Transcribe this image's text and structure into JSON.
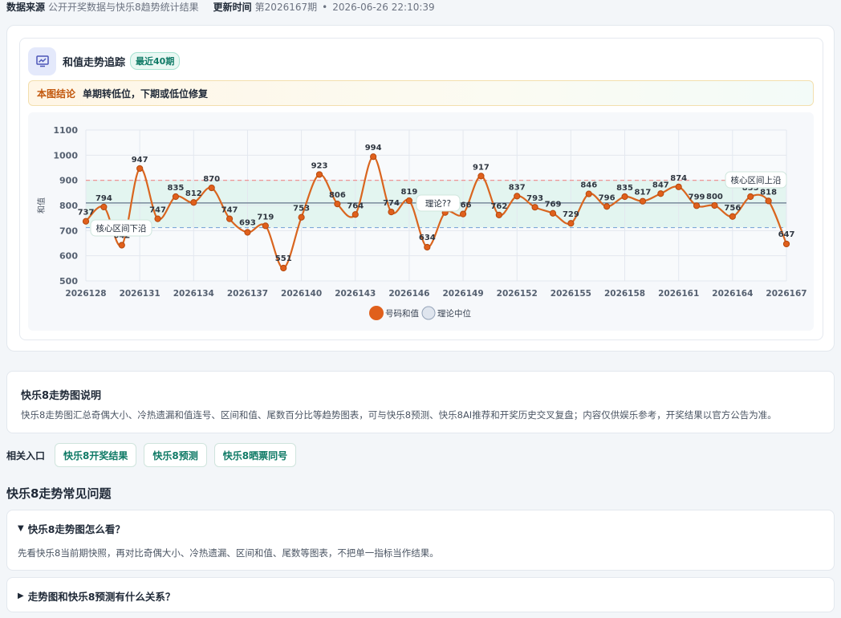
{
  "meta": {
    "source_label": "数据来源",
    "source_value": "公开开奖数据与快乐8趋势统计结果",
    "updated_label": "更新时间",
    "updated_issue": "第2026167期",
    "separator": "•",
    "updated_time": "2026-06-26 22:10:39"
  },
  "chart_card": {
    "title": "和值走势追踪",
    "badge": "最近40期",
    "icon": "presentation-chart-icon",
    "conclusion_tag": "本图结论",
    "conclusion_text": "单期转低位，下期或低位修复"
  },
  "chart_data": {
    "type": "line",
    "ylabel": "和值",
    "ylim": [
      500,
      1100
    ],
    "yticks": [
      500,
      600,
      700,
      800,
      900,
      1000,
      1100
    ],
    "x": [
      2026128,
      2026129,
      2026130,
      2026131,
      2026132,
      2026133,
      2026134,
      2026135,
      2026136,
      2026137,
      2026138,
      2026139,
      2026140,
      2026141,
      2026142,
      2026143,
      2026144,
      2026145,
      2026146,
      2026147,
      2026148,
      2026149,
      2026150,
      2026151,
      2026152,
      2026153,
      2026154,
      2026155,
      2026156,
      2026157,
      2026158,
      2026159,
      2026160,
      2026161,
      2026162,
      2026163,
      2026164,
      2026165,
      2026166,
      2026167
    ],
    "xticks": [
      "2026128",
      "2026131",
      "2026134",
      "2026137",
      "2026140",
      "2026143",
      "2026146",
      "2026149",
      "2026152",
      "2026155",
      "2026158",
      "2026161",
      "2026164",
      "2026167"
    ],
    "series": [
      {
        "name": "号码和值",
        "color": "#d9651f",
        "values": [
          737,
          794,
          642,
          947,
          747,
          835,
          812,
          870,
          747,
          693,
          719,
          551,
          753,
          923,
          806,
          764,
          994,
          774,
          819,
          634,
          772,
          766,
          917,
          762,
          837,
          793,
          769,
          729,
          846,
          796,
          835,
          817,
          847,
          874,
          799,
          800,
          756,
          835,
          818,
          647
        ]
      }
    ],
    "reference_lines": [
      {
        "name": "理论中位",
        "value": 810,
        "color": "#64748b",
        "label": "理论??"
      },
      {
        "label": "核心区间上沿",
        "value": 900,
        "color": "#ef8a8a"
      },
      {
        "label": "核心区间下沿",
        "value": 712,
        "color": "#7fa9d8"
      }
    ],
    "band": [
      712,
      900
    ],
    "band_color": "#dcf3ec",
    "legend": [
      {
        "label": "号码和值",
        "color": "#e0601c"
      },
      {
        "label": "理论中位",
        "color": "#cbd5e1"
      }
    ],
    "legend_position": "bottom",
    "grid": true
  },
  "description": {
    "title": "快乐8走势图说明",
    "text": "快乐8走势图汇总奇偶大小、冷热遗漏和值连号、区间和值、尾数百分比等趋势图表，可与快乐8预测、快乐8AI推荐和开奖历史交叉复盘；内容仅供娱乐参考，开奖结果以官方公告为准。"
  },
  "related": {
    "label": "相关入口",
    "links": [
      "快乐8开奖结果",
      "快乐8预测",
      "快乐8晒票同号"
    ]
  },
  "faq": {
    "title": "快乐8走势常见问题",
    "items": [
      {
        "expanded": true,
        "marker": "▼",
        "question": "快乐8走势图怎么看？",
        "answer": "先看快乐8当前期快照，再对比奇偶大小、冷热遗漏、区间和值、尾数等图表，不把单一指标当作结果。"
      },
      {
        "expanded": false,
        "marker": "▶",
        "question": "走势图和快乐8预测有什么关系？",
        "answer": ""
      }
    ]
  }
}
